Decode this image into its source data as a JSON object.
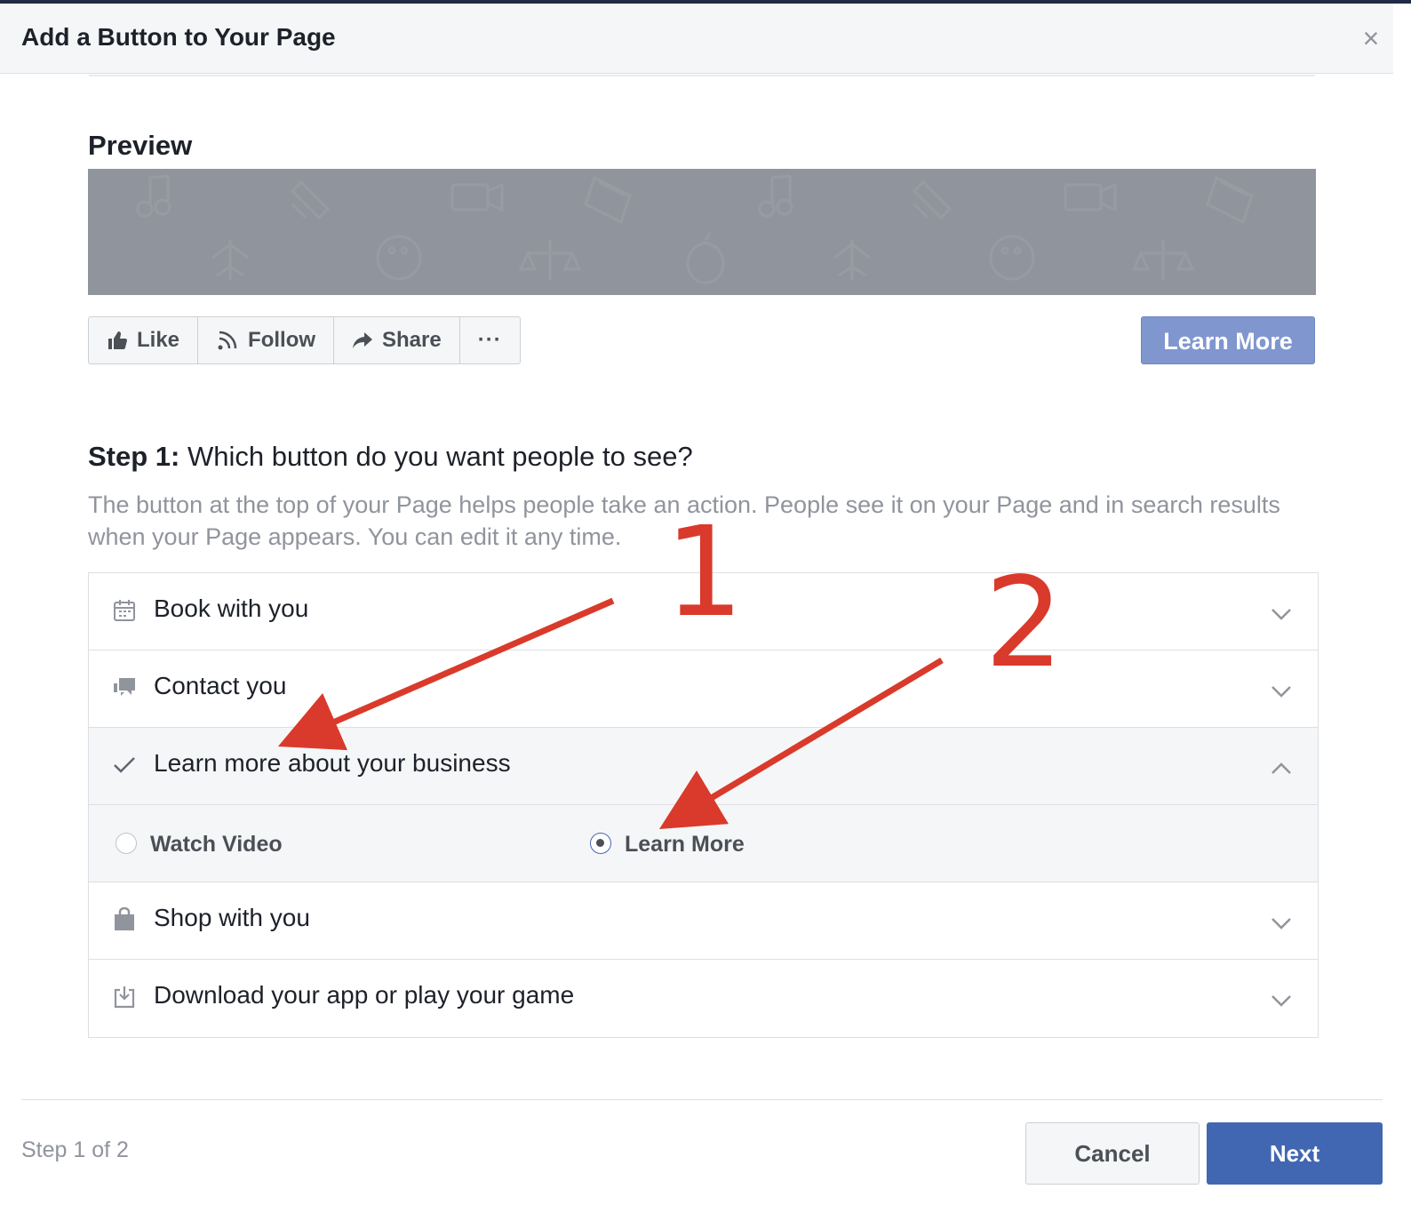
{
  "dialog": {
    "title": "Add a Button to Your Page",
    "close_icon": "close-icon"
  },
  "preview": {
    "title": "Preview",
    "actions": [
      {
        "label": "Like",
        "icon": "thumbs-up-icon"
      },
      {
        "label": "Follow",
        "icon": "rss-follow-icon"
      },
      {
        "label": "Share",
        "icon": "share-arrow-icon"
      },
      {
        "label": "···",
        "icon": "more-icon"
      }
    ],
    "cta_label": "Learn More",
    "cover_color": "#90949c",
    "cta_color": "#7f96cf"
  },
  "step": {
    "heading_bold": "Step 1:",
    "heading_text": " Which button do you want people to see?",
    "description": "The button at the top of your Page helps people take an action. People see it on your Page and in search results when your Page appears. You can edit it any time."
  },
  "options": [
    {
      "label": "Book with you",
      "icon": "calendar-icon",
      "expanded": false
    },
    {
      "label": "Contact you",
      "icon": "chat-bubbles-icon",
      "expanded": false
    },
    {
      "label": "Learn more about your business",
      "icon": "checkmark-icon",
      "expanded": true,
      "selected": true
    },
    {
      "label": "Shop with you",
      "icon": "shopping-bag-icon",
      "expanded": false
    },
    {
      "label": "Download your app or play your game",
      "icon": "download-icon",
      "expanded": false
    }
  ],
  "suboptions": [
    {
      "label": "Watch Video",
      "checked": false
    },
    {
      "label": "Learn More",
      "checked": true
    }
  ],
  "footer": {
    "step_count": "Step 1 of 2",
    "cancel_label": "Cancel",
    "next_label": "Next",
    "next_color": "#4267b2"
  },
  "annotations": {
    "marker_1": "1",
    "marker_2": "2",
    "color": "#d93a2b"
  }
}
